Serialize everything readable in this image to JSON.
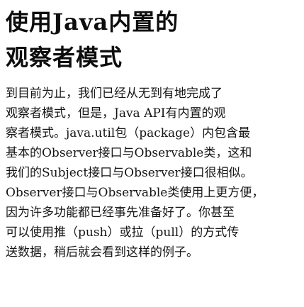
{
  "heading": {
    "lines": [
      "使用Java内置的",
      "观察者模式"
    ]
  },
  "paragraph": {
    "lines": [
      "到目前为止，我们已经从无到有地完成了",
      "观察者模式，但是，Java API有内置的观",
      "察者模式。java.util包（package）内包含最",
      "基本的Observer接口与Observable类，这和",
      "我们的Subject接口与Observer接口很相似。",
      "Observer接口与Observable类使用上更方便，",
      "因为许多功能都已经事先准备好了。你甚至",
      "可以使用推（push）或拉（pull）的方式传",
      "送数据，稍后就会看到这样的例子。"
    ]
  }
}
